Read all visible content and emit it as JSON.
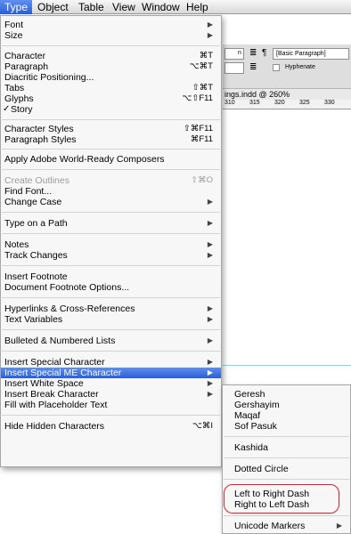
{
  "menubar": {
    "items": [
      "Type",
      "Object",
      "Table",
      "View",
      "Window",
      "Help"
    ]
  },
  "background": {
    "paragraph_style": "[Basic Paragraph]",
    "hyphenate": "Hyphenate",
    "doc_title": "ings.indd @ 260%",
    "ruler": [
      "310",
      "315",
      "320",
      "325",
      "330"
    ],
    "field_fragment": "n"
  },
  "type_menu": {
    "font": "Font",
    "size": "Size",
    "character": "Character",
    "character_sc": "⌘T",
    "paragraph": "Paragraph",
    "paragraph_sc": "⌥⌘T",
    "diacritic": "Diacritic Positioning...",
    "tabs": "Tabs",
    "tabs_sc": "⇧⌘T",
    "glyphs": "Glyphs",
    "glyphs_sc": "⌥⇧F11",
    "story": "Story",
    "story_check": "✓",
    "character_styles": "Character Styles",
    "character_styles_sc": "⇧⌘F11",
    "paragraph_styles": "Paragraph Styles",
    "paragraph_styles_sc": "⌘F11",
    "apply_composers": "Apply Adobe World-Ready Composers",
    "create_outlines": "Create Outlines",
    "create_outlines_sc": "⇧⌘O",
    "find_font": "Find Font...",
    "change_case": "Change Case",
    "type_on_path": "Type on a Path",
    "notes": "Notes",
    "track_changes": "Track Changes",
    "insert_footnote": "Insert Footnote",
    "doc_footnote_options": "Document Footnote Options...",
    "hyperlinks": "Hyperlinks & Cross-References",
    "text_variables": "Text Variables",
    "bulleted_lists": "Bulleted & Numbered Lists",
    "insert_special_char": "Insert Special Character",
    "insert_special_me_char": "Insert Special ME Character",
    "insert_white_space": "Insert White Space",
    "insert_break_char": "Insert Break Character",
    "fill_placeholder": "Fill with Placeholder Text",
    "hide_hidden_chars": "Hide Hidden Characters",
    "hide_hidden_chars_sc": "⌥⌘I",
    "submenu_arrow": "▶"
  },
  "me_submenu": {
    "geresh": "Geresh",
    "gershayim": "Gershayim",
    "maqaf": "Maqaf",
    "sof_pasuk": "Sof Pasuk",
    "kashida": "Kashida",
    "dotted_circle": "Dotted Circle",
    "ltr_dash": "Left to Right Dash",
    "rtl_dash": "Right to Left Dash",
    "unicode_markers": "Unicode Markers",
    "submenu_arrow": "▶"
  }
}
